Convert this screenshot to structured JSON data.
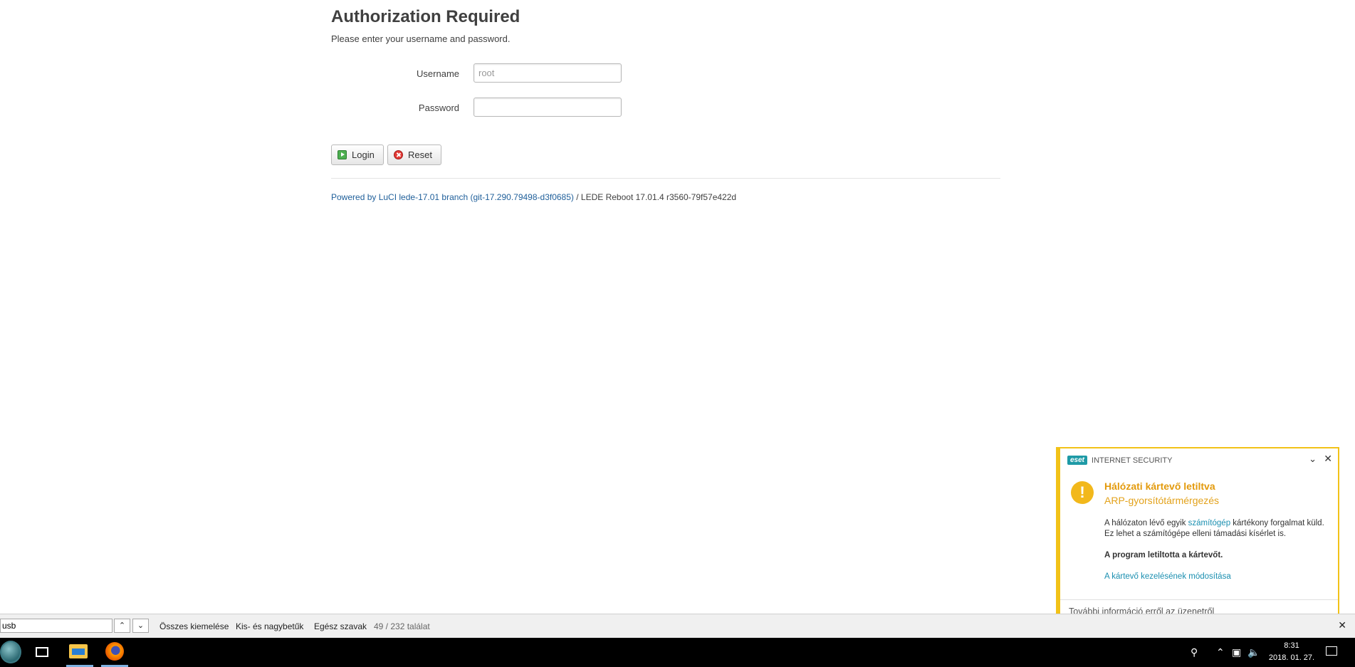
{
  "login": {
    "title": "Authorization Required",
    "subtitle": "Please enter your username and password.",
    "username_label": "Username",
    "username_placeholder": "root",
    "password_label": "Password",
    "login_button": "Login",
    "reset_button": "Reset"
  },
  "footer": {
    "powered_link": "Powered by LuCI lede-17.01 branch (git-17.290.79498-d3f0685)",
    "rest": " / LEDE Reboot 17.01.4 r3560-79f57e422d"
  },
  "eset": {
    "logo": "eset",
    "product": "INTERNET SECURITY",
    "title": "Hálózati kártevő letiltva",
    "subtitle": "ARP-gyorsítótármérgezés",
    "body_pre": "A hálózaton lévő egyik ",
    "body_link": "számítógép",
    "body_post": " kártékony forgalmat küld. Ez lehet a számítógépe elleni támadási kísérlet is.",
    "blocked": "A program letiltotta a kártevőt.",
    "change_link": "A kártevő kezelésének módosítása",
    "footer": "További információ erről az üzenetről",
    "accent_color": "#f2c218"
  },
  "findbar": {
    "query": "usb",
    "prev_icon": "chevron-up-icon",
    "next_icon": "chevron-down-icon",
    "highlight_all": "Összes kiemelése",
    "match_case": "Kis- és nagybetűk",
    "whole_words": "Egész szavak",
    "count": "49 / 232 találat"
  },
  "taskbar": {
    "time": "8:31",
    "date": "2018. 01. 27."
  }
}
